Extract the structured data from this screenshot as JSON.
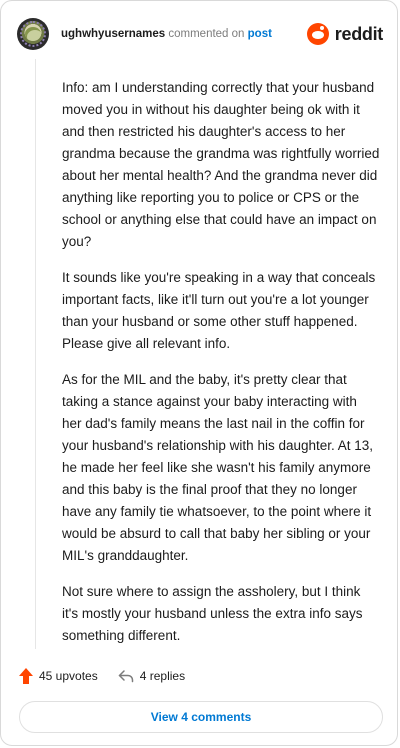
{
  "header": {
    "username": "ughwhyusernames",
    "commented_text": "commented on",
    "post_link": "post",
    "brand": "reddit"
  },
  "comment": {
    "paragraphs": [
      "Info: am I understanding correctly that your husband moved you in without his daughter being ok with it and then restricted his daughter's access to her grandma because the grandma was rightfully worried about her mental health? And the grandma never did anything like reporting you to police or CPS or the school or anything else that could have an impact on you?",
      "It sounds like you're speaking in a way that conceals important facts, like it'll turn out you're a lot younger than your husband or some other stuff happened. Please give all relevant info.",
      "As for the MIL and the baby, it's pretty clear that taking a stance against your baby interacting with her dad's family means the last nail in the coffin for your husband's relationship with his daughter. At 13, he made her feel like she wasn't his family anymore and this baby is the final proof that they no longer have any family tie whatsoever, to the point where it would be absurd to call that baby her sibling or your MIL's granddaughter.",
      "Not sure where to assign the assholery, but I think it's mostly your husband unless the extra info says something different."
    ]
  },
  "actions": {
    "upvotes_label": "45 upvotes",
    "replies_label": "4 replies"
  },
  "footer": {
    "view_comments_label": "View 4 comments"
  },
  "colors": {
    "brand": "#ff4500",
    "link": "#0079d3",
    "text": "#1c1c1c",
    "muted": "#7c7c7c"
  },
  "icons": {
    "avatar": "avatar",
    "brand": "reddit-logo-icon",
    "upvote": "upvote-arrow-icon",
    "reply": "reply-arrow-icon"
  }
}
